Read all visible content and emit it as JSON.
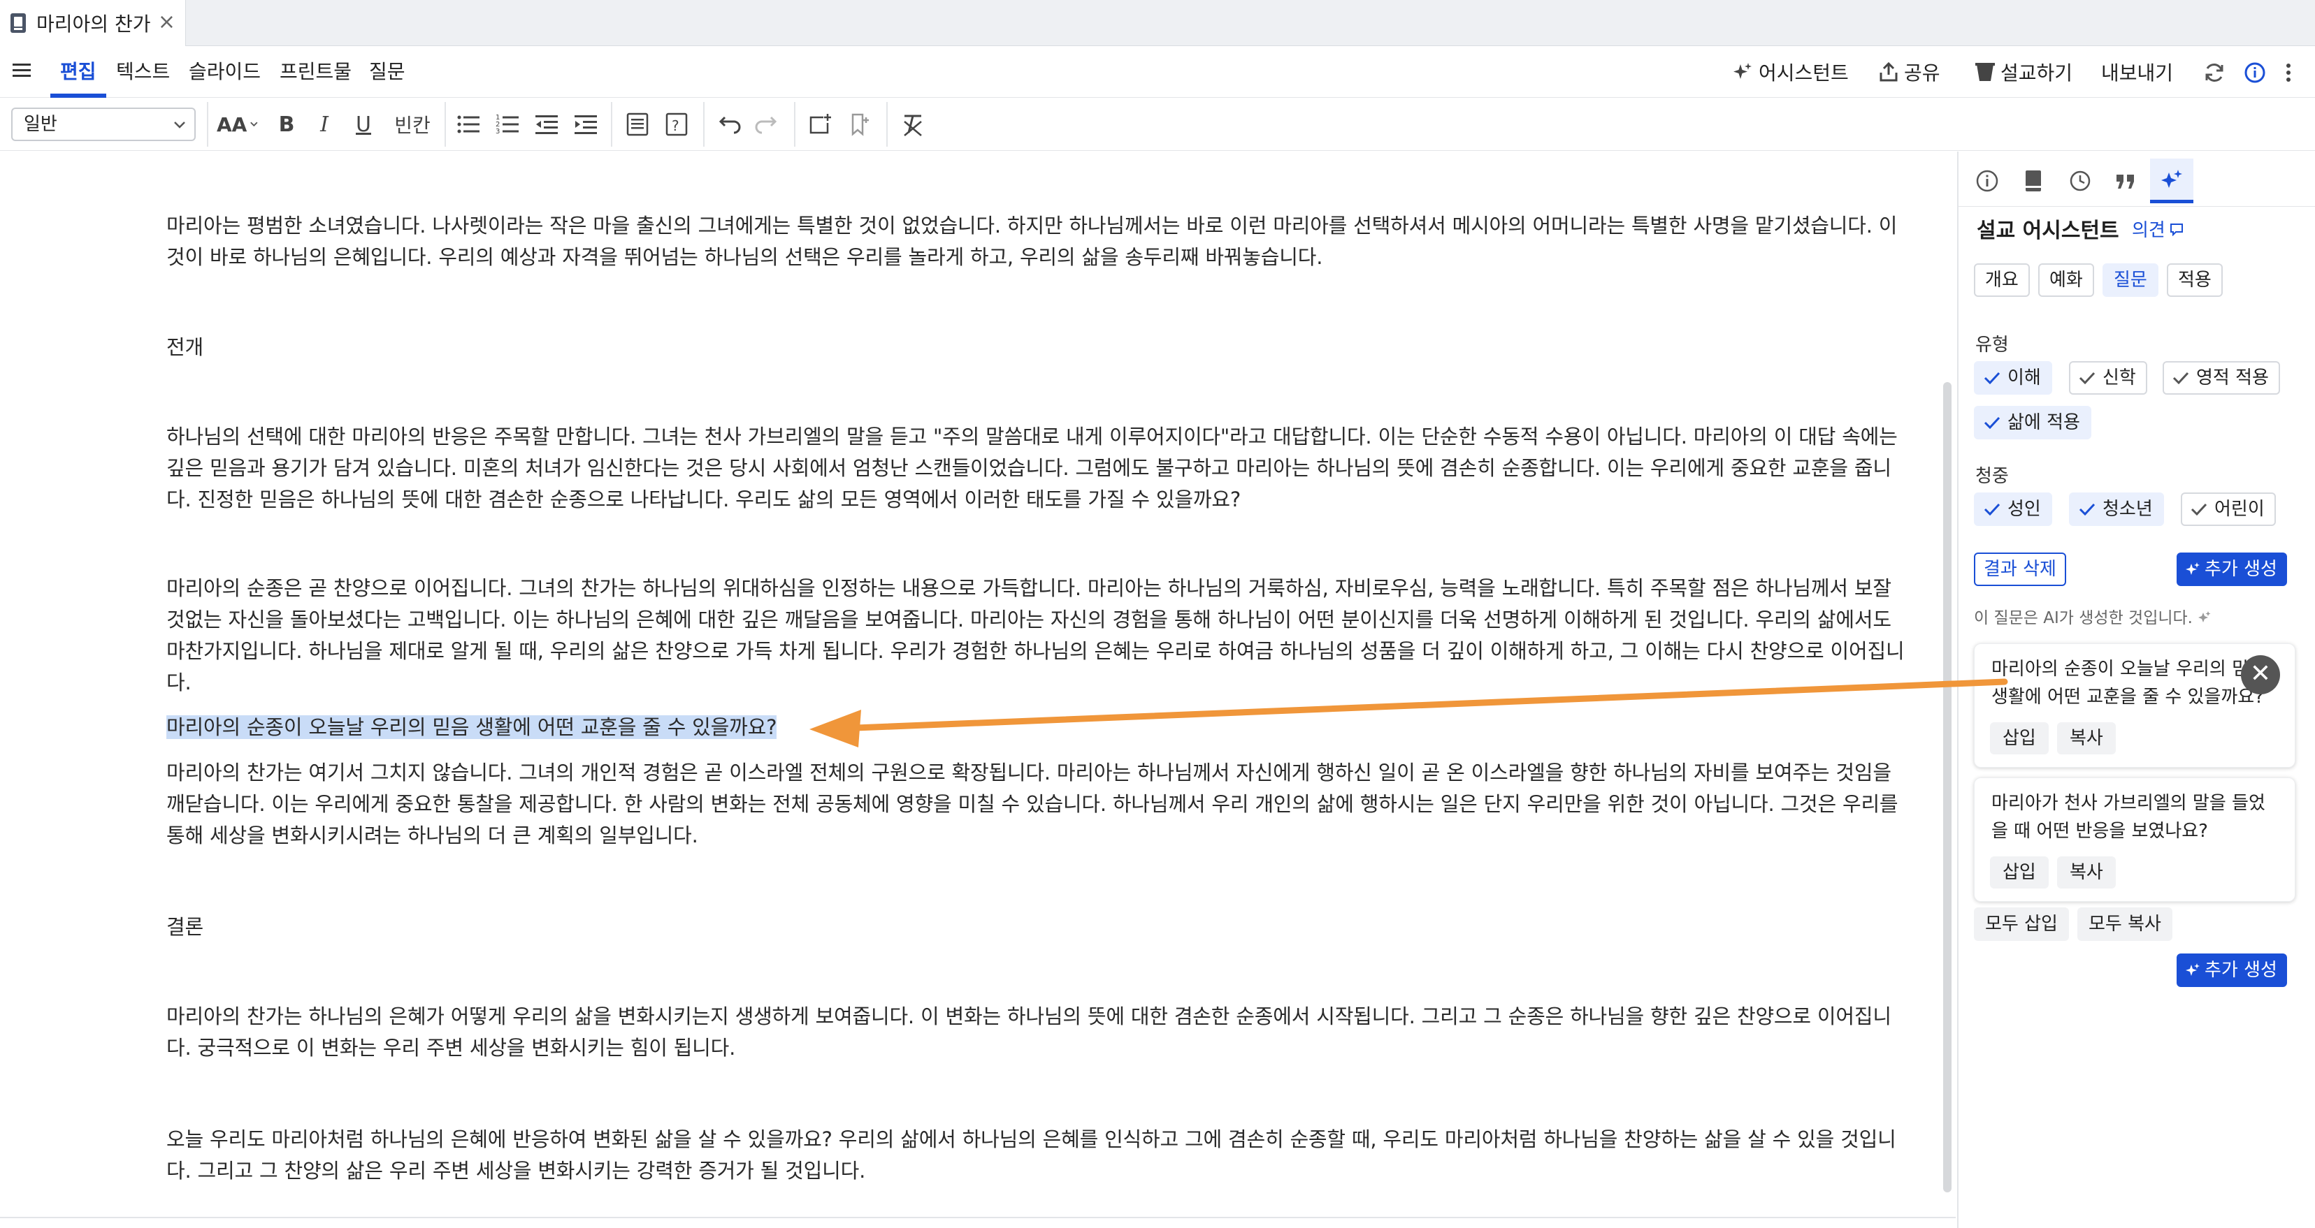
{
  "window": {
    "tab_title": "마리아의 찬가",
    "close_glyph": "×"
  },
  "menu": {
    "tabs": [
      "편집",
      "텍스트",
      "슬라이드",
      "프린트물",
      "질문"
    ],
    "active_tab": "편집",
    "assistant": "어시스턴트",
    "share": "공유",
    "preach": "설교하기",
    "export": "내보내기"
  },
  "toolbar": {
    "style_value": "일반",
    "font_size_glyph": "AA",
    "bold": "B",
    "italic": "I",
    "underline": "U",
    "blank": "빈칸"
  },
  "document": {
    "paragraphs": [
      "마리아는 평범한 소녀였습니다. 나사렛이라는 작은 마을 출신의 그녀에게는 특별한 것이 없었습니다. 하지만 하나님께서는 바로 이런 마리아를 선택하셔서 메시아의 어머니라는 특별한 사명을 맡기셨습니다. 이것이 바로 하나님의 은혜입니다. 우리의 예상과 자격을 뛰어넘는 하나님의 선택은 우리를 놀라게 하고, 우리의 삶을 송두리째 바꿔놓습니다.",
      "전개",
      "하나님의 선택에 대한 마리아의 반응은 주목할 만합니다. 그녀는 천사 가브리엘의 말을 듣고 \"주의 말씀대로 내게 이루어지이다\"라고 대답합니다. 이는 단순한 수동적 수용이 아닙니다. 마리아의 이 대답 속에는 깊은 믿음과 용기가 담겨 있습니다. 미혼의 처녀가 임신한다는 것은 당시 사회에서 엄청난 스캔들이었습니다. 그럼에도 불구하고 마리아는 하나님의 뜻에 겸손히 순종합니다. 이는 우리에게 중요한 교훈을 줍니다. 진정한 믿음은 하나님의 뜻에 대한 겸손한 순종으로 나타납니다. 우리도 삶의 모든 영역에서 이러한 태도를 가질 수 있을까요?",
      "마리아의 순종은 곧 찬양으로 이어집니다. 그녀의 찬가는 하나님의 위대하심을 인정하는 내용으로 가득합니다. 마리아는 하나님의 거룩하심, 자비로우심, 능력을 노래합니다. 특히 주목할 점은 하나님께서 보잘것없는 자신을 돌아보셨다는 고백입니다. 이는 하나님의 은혜에 대한 깊은 깨달음을 보여줍니다. 마리아는 자신의 경험을 통해 하나님이 어떤 분이신지를 더욱 선명하게 이해하게 된 것입니다. 우리의 삶에서도 마찬가지입니다. 하나님을 제대로 알게 될 때, 우리의 삶은 찬양으로 가득 차게 됩니다. 우리가 경험한 하나님의 은혜는 우리로 하여금 하나님의 성품을 더 깊이 이해하게 하고, 그 이해는 다시 찬양으로 이어집니다.",
      "마리아의 순종이 오늘날 우리의 믿음 생활에 어떤 교훈을 줄 수 있을까요?",
      "마리아의 찬가는 여기서 그치지 않습니다. 그녀의 개인적 경험은 곧 이스라엘 전체의 구원으로 확장됩니다. 마리아는 하나님께서 자신에게 행하신 일이 곧 온 이스라엘을 향한 하나님의 자비를 보여주는 것임을 깨닫습니다. 이는 우리에게 중요한 통찰을 제공합니다. 한 사람의 변화는 전체 공동체에 영향을 미칠 수 있습니다. 하나님께서 우리 개인의 삶에 행하시는 일은 단지 우리만을 위한 것이 아닙니다. 그것은 우리를 통해 세상을 변화시키시려는 하나님의 더 큰 계획의 일부입니다.",
      "결론",
      "마리아의 찬가는 하나님의 은혜가 어떻게 우리의 삶을 변화시키는지 생생하게 보여줍니다. 이 변화는 하나님의 뜻에 대한 겸손한 순종에서 시작됩니다. 그리고 그 순종은 하나님을 향한 깊은 찬양으로 이어집니다. 궁극적으로 이 변화는 우리 주변 세상을 변화시키는 힘이 됩니다.",
      "오늘 우리도 마리아처럼 하나님의 은혜에 반응하여 변화된 삶을 살 수 있을까요? 우리의 삶에서 하나님의 은혜를 인식하고 그에 겸손히 순종할 때, 우리도 마리아처럼 하나님을 찬양하는 삶을 살 수 있을 것입니다. 그리고 그 찬양의 삶은 우리 주변 세상을 변화시키는 강력한 증거가 될 것입니다."
    ]
  },
  "panel": {
    "title": "설교 어시스턴트",
    "feedback": "의견",
    "mode_tabs": [
      "개요",
      "예화",
      "질문",
      "적용"
    ],
    "active_mode": "질문",
    "type_label": "유형",
    "type_options": [
      "이해",
      "신학",
      "영적 적용",
      "삶에 적용"
    ],
    "audience_label": "청중",
    "audience_options": [
      "성인",
      "청소년",
      "어린이"
    ],
    "clear_results": "결과 삭제",
    "generate_more": "추가 생성",
    "ai_note": "이 질문은 AI가 생성한 것입니다.",
    "cards": [
      {
        "text": "마리아의 순종이 오늘날 우리의 믿음 생활에 어떤 교훈을 줄 수 있을까요?",
        "insert": "삽입",
        "copy": "복사"
      },
      {
        "text": "마리아가 천사 가브리엘의 말을 들었을 때 어떤 반응을 보였나요?",
        "insert": "삽입",
        "copy": "복사"
      }
    ],
    "insert_all": "모두 삽입",
    "copy_all": "모두 복사",
    "close_glyph": "✕"
  },
  "colors": {
    "accent": "#1a4fd6",
    "selection": "#c9dcf7",
    "arrow": "#f0963a"
  }
}
